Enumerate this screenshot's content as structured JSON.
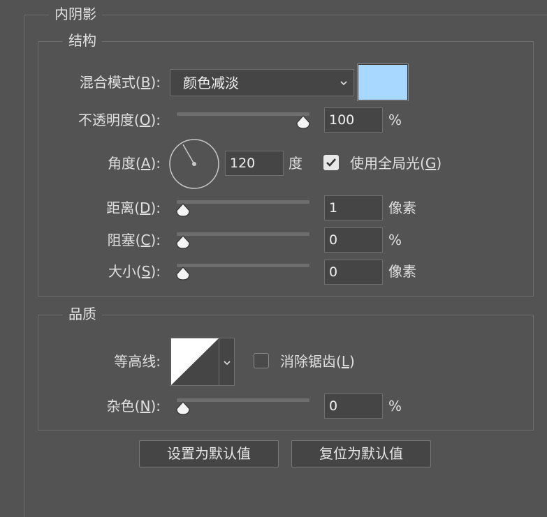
{
  "panel": {
    "title": "内阴影"
  },
  "structure": {
    "legend": "结构",
    "blend_mode": {
      "label_pre": "混合模式(",
      "label_key": "B",
      "label_post": "):",
      "value": "颜色减淡",
      "swatch_color": "#a8d8ff"
    },
    "opacity": {
      "label_pre": "不透明度(",
      "label_key": "O",
      "label_post": "):",
      "value": "100",
      "unit": "%",
      "fraction": 1.0
    },
    "angle": {
      "label_pre": "角度(",
      "label_key": "A",
      "label_post": "):",
      "value": "120",
      "unit": "度",
      "degrees": 120
    },
    "global_light": {
      "label_pre": "使用全局光(",
      "label_key": "G",
      "label_post": ")",
      "checked": true
    },
    "distance": {
      "label_pre": "距离(",
      "label_key": "D",
      "label_post": "):",
      "value": "1",
      "unit": "像素",
      "fraction": 0.0
    },
    "choke": {
      "label_pre": "阻塞(",
      "label_key": "C",
      "label_post": "):",
      "value": "0",
      "unit": "%",
      "fraction": 0.0
    },
    "size": {
      "label_pre": "大小(",
      "label_key": "S",
      "label_post": "):",
      "value": "0",
      "unit": "像素",
      "fraction": 0.0
    }
  },
  "quality": {
    "legend": "品质",
    "contour": {
      "label": "等高线:"
    },
    "anti_alias": {
      "label_pre": "消除锯齿(",
      "label_key": "L",
      "label_post": ")",
      "checked": false
    },
    "noise": {
      "label_pre": "杂色(",
      "label_key": "N",
      "label_post": "):",
      "value": "0",
      "unit": "%",
      "fraction": 0.0
    }
  },
  "buttons": {
    "set_default": "设置为默认值",
    "reset_default": "复位为默认值"
  },
  "icons": {
    "dropdown": "chevron-down-icon",
    "check": "checkmark-icon",
    "thumb": "slider-thumb-icon",
    "angle": "angle-dial-icon",
    "contour": "contour-curve-icon"
  },
  "colors": {
    "background": "#535353",
    "input_bg": "#454545",
    "border": "#6d6d6d"
  }
}
